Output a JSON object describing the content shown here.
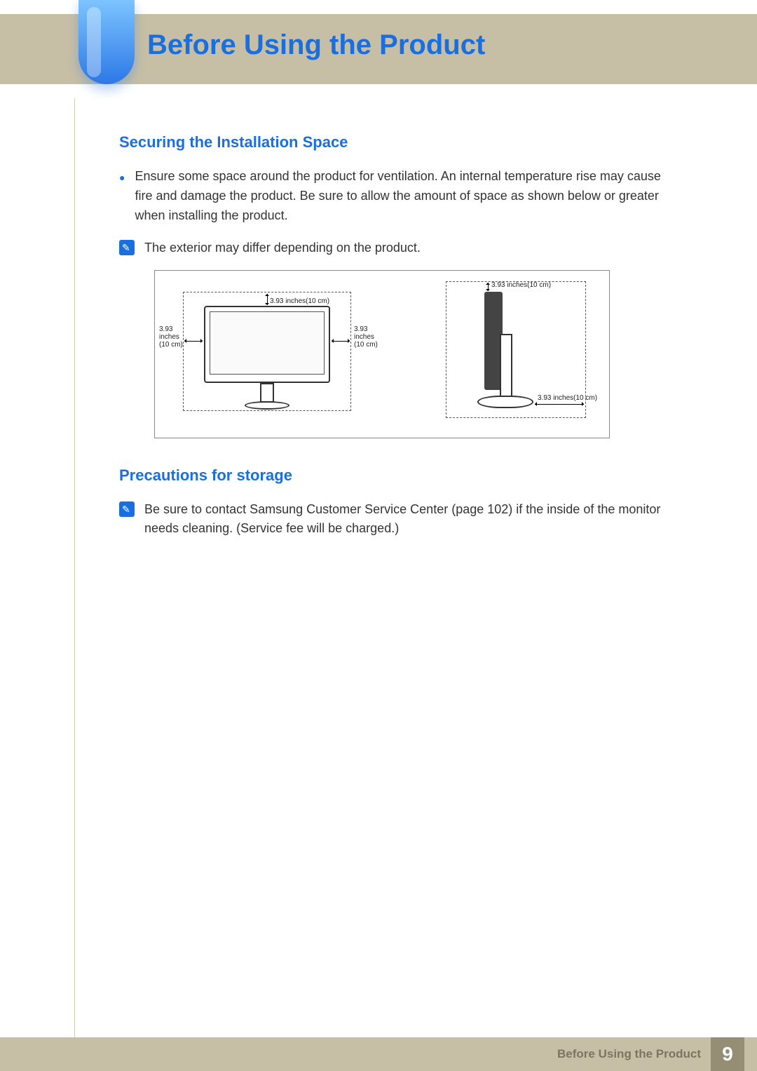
{
  "header": {
    "title": "Before Using the Product"
  },
  "section1": {
    "title": "Securing the Installation Space",
    "bullet": "Ensure some space around the product for ventilation. An internal temperature rise may cause fire and damage the product. Be sure to allow the amount of space as shown below or greater when installing the product.",
    "note": "The exterior may differ depending on the product."
  },
  "diagram": {
    "dim_top": "3.93 inches(10 cm)",
    "dim_left_line1": "3.93",
    "dim_left_line2": "inches",
    "dim_left_line3": "(10 cm)",
    "dim_right_line1": "3.93",
    "dim_right_line2": "inches",
    "dim_right_line3": "(10 cm)",
    "dim_side_top": "3.93 inches(10 cm)",
    "dim_side_bottom": "3.93 inches(10 cm)"
  },
  "section2": {
    "title": "Precautions for storage",
    "note": "Be sure to contact Samsung Customer Service Center (page 102) if the inside of the monitor needs cleaning. (Service fee will be charged.)"
  },
  "footer": {
    "chapter": "Before Using the Product",
    "page": "9"
  }
}
